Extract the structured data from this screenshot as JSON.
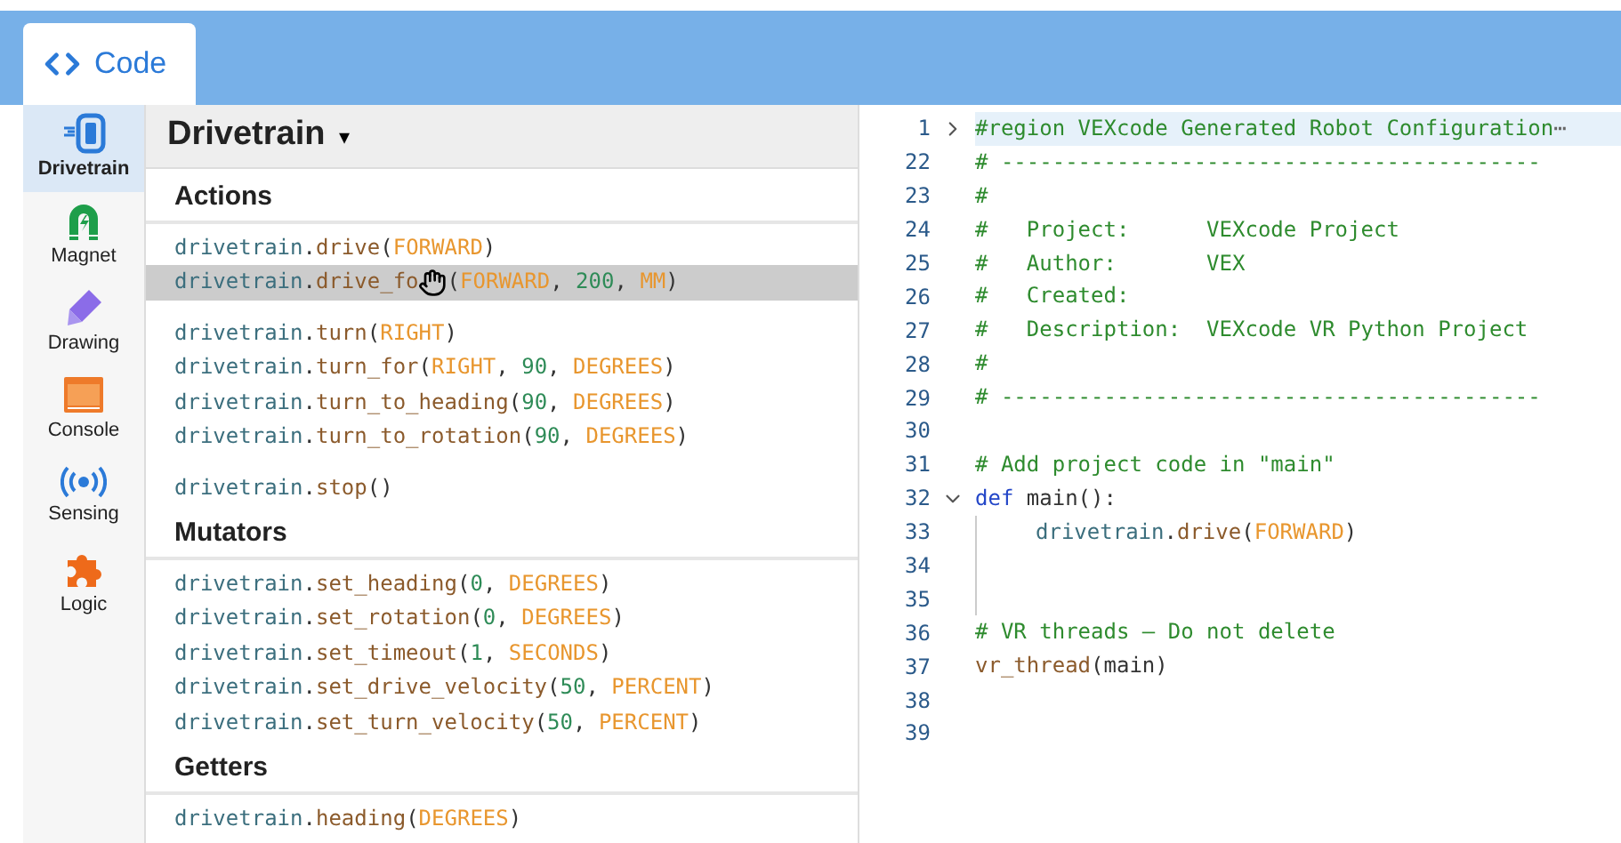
{
  "tab": {
    "label": "Code",
    "selected": true
  },
  "categories": [
    {
      "label": "Drivetrain",
      "kind": "drivetrain",
      "selected": true
    },
    {
      "label": "Magnet",
      "kind": "magnet",
      "selected": false
    },
    {
      "label": "Drawing",
      "kind": "drawing",
      "selected": false
    },
    {
      "label": "Console",
      "kind": "console",
      "selected": false
    },
    {
      "label": "Sensing",
      "kind": "sensing",
      "selected": false
    },
    {
      "label": "Logic",
      "kind": "logic",
      "selected": false
    }
  ],
  "panel": {
    "title": "Drivetrain",
    "caret": "▾",
    "sections": [
      {
        "heading": "Actions",
        "groups": [
          [
            {
              "selected": false,
              "tokens": [
                {
                  "text": "drivetrain",
                  "kind": "obj"
                },
                {
                  "text": ".",
                  "kind": "punct"
                },
                {
                  "text": "drive",
                  "kind": "fn"
                },
                {
                  "text": "(",
                  "kind": "punct"
                },
                {
                  "text": "FORWARD",
                  "kind": "const"
                },
                {
                  "text": ")",
                  "kind": "punct"
                }
              ]
            },
            {
              "selected": true,
              "tokens": [
                {
                  "text": "drivetrain",
                  "kind": "obj"
                },
                {
                  "text": ".",
                  "kind": "punct"
                },
                {
                  "text": "drive_fo",
                  "kind": "fn"
                },
                {
                  "kind": "cursor"
                },
                {
                  "text": "(",
                  "kind": "punct"
                },
                {
                  "text": "FORWARD",
                  "kind": "const"
                },
                {
                  "text": ", ",
                  "kind": "punct"
                },
                {
                  "text": "200",
                  "kind": "num"
                },
                {
                  "text": ", ",
                  "kind": "punct"
                },
                {
                  "text": "MM",
                  "kind": "const"
                },
                {
                  "text": ")",
                  "kind": "punct"
                }
              ]
            }
          ],
          [
            {
              "selected": false,
              "tokens": [
                {
                  "text": "drivetrain",
                  "kind": "obj"
                },
                {
                  "text": ".",
                  "kind": "punct"
                },
                {
                  "text": "turn",
                  "kind": "fn"
                },
                {
                  "text": "(",
                  "kind": "punct"
                },
                {
                  "text": "RIGHT",
                  "kind": "const"
                },
                {
                  "text": ")",
                  "kind": "punct"
                }
              ]
            },
            {
              "selected": false,
              "tokens": [
                {
                  "text": "drivetrain",
                  "kind": "obj"
                },
                {
                  "text": ".",
                  "kind": "punct"
                },
                {
                  "text": "turn_for",
                  "kind": "fn"
                },
                {
                  "text": "(",
                  "kind": "punct"
                },
                {
                  "text": "RIGHT",
                  "kind": "const"
                },
                {
                  "text": ", ",
                  "kind": "punct"
                },
                {
                  "text": "90",
                  "kind": "num"
                },
                {
                  "text": ", ",
                  "kind": "punct"
                },
                {
                  "text": "DEGREES",
                  "kind": "const"
                },
                {
                  "text": ")",
                  "kind": "punct"
                }
              ]
            },
            {
              "selected": false,
              "tokens": [
                {
                  "text": "drivetrain",
                  "kind": "obj"
                },
                {
                  "text": ".",
                  "kind": "punct"
                },
                {
                  "text": "turn_to_heading",
                  "kind": "fn"
                },
                {
                  "text": "(",
                  "kind": "punct"
                },
                {
                  "text": "90",
                  "kind": "num"
                },
                {
                  "text": ", ",
                  "kind": "punct"
                },
                {
                  "text": "DEGREES",
                  "kind": "const"
                },
                {
                  "text": ")",
                  "kind": "punct"
                }
              ]
            },
            {
              "selected": false,
              "tokens": [
                {
                  "text": "drivetrain",
                  "kind": "obj"
                },
                {
                  "text": ".",
                  "kind": "punct"
                },
                {
                  "text": "turn_to_rotation",
                  "kind": "fn"
                },
                {
                  "text": "(",
                  "kind": "punct"
                },
                {
                  "text": "90",
                  "kind": "num"
                },
                {
                  "text": ", ",
                  "kind": "punct"
                },
                {
                  "text": "DEGREES",
                  "kind": "const"
                },
                {
                  "text": ")",
                  "kind": "punct"
                }
              ]
            }
          ],
          [
            {
              "selected": false,
              "tokens": [
                {
                  "text": "drivetrain",
                  "kind": "obj"
                },
                {
                  "text": ".",
                  "kind": "punct"
                },
                {
                  "text": "stop",
                  "kind": "fn"
                },
                {
                  "text": "()",
                  "kind": "punct"
                }
              ]
            }
          ]
        ]
      },
      {
        "heading": "Mutators",
        "groups": [
          [
            {
              "selected": false,
              "tokens": [
                {
                  "text": "drivetrain",
                  "kind": "obj"
                },
                {
                  "text": ".",
                  "kind": "punct"
                },
                {
                  "text": "set_heading",
                  "kind": "fn"
                },
                {
                  "text": "(",
                  "kind": "punct"
                },
                {
                  "text": "0",
                  "kind": "num"
                },
                {
                  "text": ", ",
                  "kind": "punct"
                },
                {
                  "text": "DEGREES",
                  "kind": "const"
                },
                {
                  "text": ")",
                  "kind": "punct"
                }
              ]
            },
            {
              "selected": false,
              "tokens": [
                {
                  "text": "drivetrain",
                  "kind": "obj"
                },
                {
                  "text": ".",
                  "kind": "punct"
                },
                {
                  "text": "set_rotation",
                  "kind": "fn"
                },
                {
                  "text": "(",
                  "kind": "punct"
                },
                {
                  "text": "0",
                  "kind": "num"
                },
                {
                  "text": ", ",
                  "kind": "punct"
                },
                {
                  "text": "DEGREES",
                  "kind": "const"
                },
                {
                  "text": ")",
                  "kind": "punct"
                }
              ]
            },
            {
              "selected": false,
              "tokens": [
                {
                  "text": "drivetrain",
                  "kind": "obj"
                },
                {
                  "text": ".",
                  "kind": "punct"
                },
                {
                  "text": "set_timeout",
                  "kind": "fn"
                },
                {
                  "text": "(",
                  "kind": "punct"
                },
                {
                  "text": "1",
                  "kind": "num"
                },
                {
                  "text": ", ",
                  "kind": "punct"
                },
                {
                  "text": "SECONDS",
                  "kind": "const"
                },
                {
                  "text": ")",
                  "kind": "punct"
                }
              ]
            },
            {
              "selected": false,
              "tokens": [
                {
                  "text": "drivetrain",
                  "kind": "obj"
                },
                {
                  "text": ".",
                  "kind": "punct"
                },
                {
                  "text": "set_drive_velocity",
                  "kind": "fn"
                },
                {
                  "text": "(",
                  "kind": "punct"
                },
                {
                  "text": "50",
                  "kind": "num"
                },
                {
                  "text": ", ",
                  "kind": "punct"
                },
                {
                  "text": "PERCENT",
                  "kind": "const"
                },
                {
                  "text": ")",
                  "kind": "punct"
                }
              ]
            },
            {
              "selected": false,
              "tokens": [
                {
                  "text": "drivetrain",
                  "kind": "obj"
                },
                {
                  "text": ".",
                  "kind": "punct"
                },
                {
                  "text": "set_turn_velocity",
                  "kind": "fn"
                },
                {
                  "text": "(",
                  "kind": "punct"
                },
                {
                  "text": "50",
                  "kind": "num"
                },
                {
                  "text": ", ",
                  "kind": "punct"
                },
                {
                  "text": "PERCENT",
                  "kind": "const"
                },
                {
                  "text": ")",
                  "kind": "punct"
                }
              ]
            }
          ]
        ]
      },
      {
        "heading": "Getters",
        "groups": [
          [
            {
              "selected": false,
              "tokens": [
                {
                  "text": "drivetrain",
                  "kind": "obj"
                },
                {
                  "text": ".",
                  "kind": "punct"
                },
                {
                  "text": "heading",
                  "kind": "fn"
                },
                {
                  "text": "(",
                  "kind": "punct"
                },
                {
                  "text": "DEGREES",
                  "kind": "const"
                },
                {
                  "text": ")",
                  "kind": "punct"
                }
              ]
            }
          ]
        ]
      }
    ]
  },
  "editor": {
    "lines": [
      {
        "number": "1",
        "folded": true,
        "selected": true,
        "guide": false,
        "ellipsis": "⋯",
        "tokens": [
          {
            "text": "#region VEXcode Generated Robot Configuration",
            "kind": "comment"
          }
        ]
      },
      {
        "number": "22",
        "selected": false,
        "guide": false,
        "tokens": [
          {
            "text": "# ------------------------------------------",
            "kind": "comment"
          }
        ]
      },
      {
        "number": "23",
        "selected": false,
        "guide": false,
        "tokens": [
          {
            "text": "#",
            "kind": "comment"
          }
        ]
      },
      {
        "number": "24",
        "selected": false,
        "guide": false,
        "tokens": [
          {
            "text": "#   Project:      VEXcode Project",
            "kind": "comment"
          }
        ]
      },
      {
        "number": "25",
        "selected": false,
        "guide": false,
        "tokens": [
          {
            "text": "#   Author:       VEX",
            "kind": "comment"
          }
        ]
      },
      {
        "number": "26",
        "selected": false,
        "guide": false,
        "tokens": [
          {
            "text": "#   Created:",
            "kind": "comment"
          }
        ]
      },
      {
        "number": "27",
        "selected": false,
        "guide": false,
        "tokens": [
          {
            "text": "#   Description:  VEXcode VR Python Project",
            "kind": "comment"
          }
        ]
      },
      {
        "number": "28",
        "selected": false,
        "guide": false,
        "tokens": [
          {
            "text": "#",
            "kind": "comment"
          }
        ]
      },
      {
        "number": "29",
        "selected": false,
        "guide": false,
        "tokens": [
          {
            "text": "# ------------------------------------------",
            "kind": "comment"
          }
        ]
      },
      {
        "number": "30",
        "selected": false,
        "guide": false
      },
      {
        "number": "31",
        "selected": false,
        "guide": false,
        "tokens": [
          {
            "text": "# Add project code in \"main\"",
            "kind": "comment"
          }
        ]
      },
      {
        "number": "32",
        "folded": false,
        "selected": false,
        "guide": false,
        "tokens": [
          {
            "text": "def",
            "kind": "keyword"
          },
          {
            "text": " main():",
            "kind": "punct"
          }
        ]
      },
      {
        "number": "33",
        "selected": false,
        "guide": true,
        "tokens": [
          {
            "text": "drivetrain",
            "kind": "obj"
          },
          {
            "text": ".",
            "kind": "punct"
          },
          {
            "text": "drive",
            "kind": "fn"
          },
          {
            "text": "(",
            "kind": "punct"
          },
          {
            "text": "FORWARD",
            "kind": "const"
          },
          {
            "text": ")",
            "kind": "punct"
          }
        ]
      },
      {
        "number": "34",
        "selected": false,
        "guide": true
      },
      {
        "number": "35",
        "selected": false,
        "guide": true
      },
      {
        "number": "36",
        "selected": false,
        "guide": false,
        "tokens": [
          {
            "text": "# VR threads — Do not delete",
            "kind": "comment"
          }
        ]
      },
      {
        "number": "37",
        "selected": false,
        "guide": false,
        "tokens": [
          {
            "text": "vr_thread",
            "kind": "fn"
          },
          {
            "text": "(main)",
            "kind": "punct"
          }
        ]
      },
      {
        "number": "38",
        "selected": false,
        "guide": false
      },
      {
        "number": "39",
        "selected": false,
        "guide": false
      }
    ]
  }
}
